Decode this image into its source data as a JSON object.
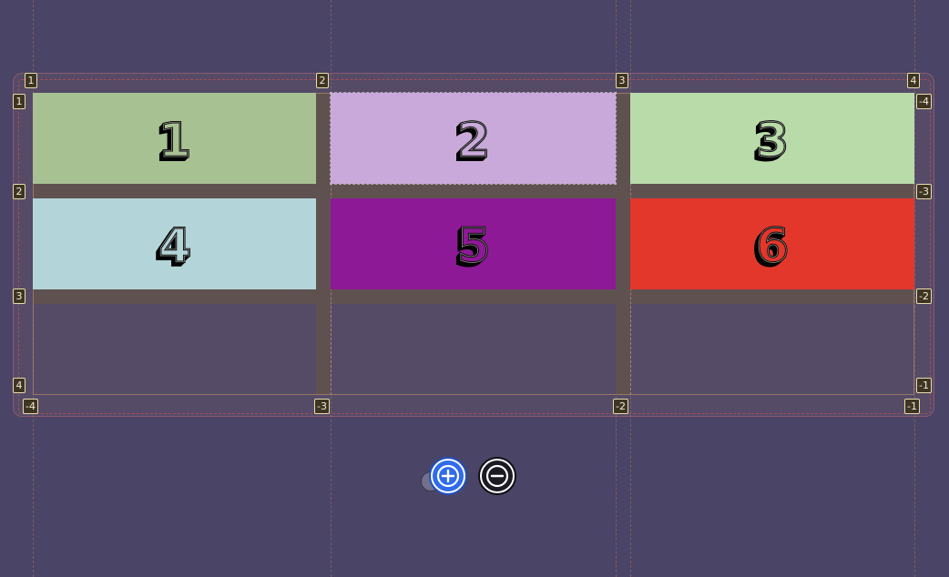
{
  "grid": {
    "items": [
      {
        "label": "1",
        "color": "#a8c193"
      },
      {
        "label": "2",
        "color": "#c9a9da"
      },
      {
        "label": "3",
        "color": "#b9dbaa"
      },
      {
        "label": "4",
        "color": "#b3d4d8"
      },
      {
        "label": "5",
        "color": "#8e1996"
      },
      {
        "label": "6",
        "color": "#e3372c"
      }
    ],
    "column_lines_top": [
      "1",
      "2",
      "3",
      "4"
    ],
    "column_lines_bottom": [
      "-4",
      "-3",
      "-2",
      "-1"
    ],
    "row_lines_left": [
      "1",
      "2",
      "3",
      "4"
    ],
    "row_lines_right": [
      "-4",
      "-3",
      "-2",
      "-1"
    ]
  },
  "controls": {
    "add_icon": "plus-circle-icon",
    "remove_icon": "minus-circle-icon",
    "add_color": "#2f6bea",
    "remove_color": "#1c1b24"
  },
  "colors": {
    "background": "#4a4466",
    "gap": "#5f5150",
    "badge_bg": "#3e3524",
    "badge_border": "#e9dcaa"
  }
}
